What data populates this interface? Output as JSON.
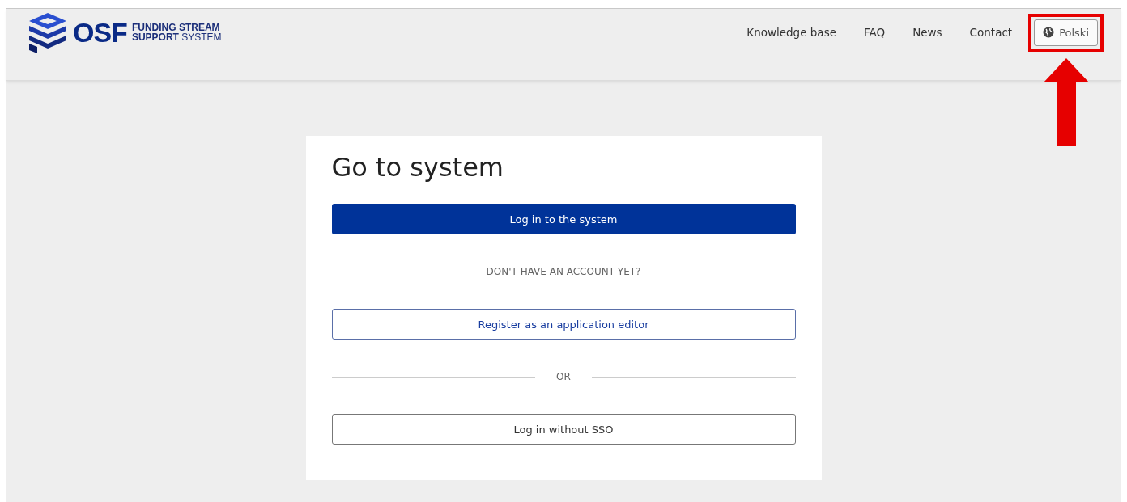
{
  "header": {
    "logo": {
      "brand": "OSF",
      "line1": "FUNDING STREAM",
      "line2_bold": "SUPPORT",
      "line2_light": "SYSTEM"
    },
    "nav": [
      {
        "label": "Knowledge base"
      },
      {
        "label": "FAQ"
      },
      {
        "label": "News"
      },
      {
        "label": "Contact"
      }
    ],
    "language_button": {
      "label": "Polski",
      "highlighted": true
    }
  },
  "card": {
    "title": "Go to system",
    "items": [
      {
        "kind": "primary",
        "label": "Log in to the system"
      },
      {
        "kind": "divider",
        "label": "DON'T HAVE AN ACCOUNT YET?"
      },
      {
        "kind": "register",
        "label": "Register as an application editor"
      },
      {
        "kind": "divider",
        "label": "OR"
      },
      {
        "kind": "secondary",
        "label": "Log in without SSO"
      }
    ]
  }
}
